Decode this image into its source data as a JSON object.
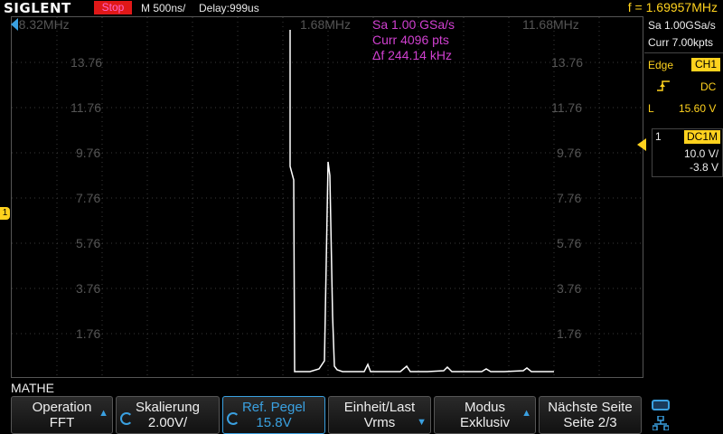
{
  "topbar": {
    "logo": "SIGLENT",
    "status": "Stop",
    "timebase": "M 500ns/",
    "delay": "Delay:999us",
    "frequency": "f = 1.69957MHz"
  },
  "grid": {
    "header": {
      "left": "-8.32MHz",
      "center": "1.68MHz",
      "right": "11.68MHz"
    },
    "scale_labels": [
      "13.76",
      "11.76",
      "9.76",
      "7.76",
      "5.76",
      "3.76",
      "1.76"
    ],
    "measurements": [
      "Sa 1.00 GSa/s",
      "Curr 4096 pts",
      "Δf 244.14 kHz"
    ],
    "trace_color": "#ffffff",
    "label_color": "#d040d0",
    "channel_marker": "1"
  },
  "right_panel": {
    "sample_rate": "Sa 1.00GSa/s",
    "memory": "Curr 7.00kpts",
    "trigger_type": "Edge",
    "trigger_source": "CH1",
    "coupling": "DC",
    "level_label": "L",
    "level_value": "15.60 V",
    "channel_number": "1",
    "channel_coupling": "DC1M",
    "volts_div": "10.0 V/",
    "offset": "-3.8 V",
    "accent": "#ffd21e"
  },
  "bottom": {
    "menu_title": "MATHE",
    "softkeys": [
      {
        "line1": "Operation",
        "line2": "FFT"
      },
      {
        "line1": "Skalierung",
        "line2": "2.00V/"
      },
      {
        "line1": "Ref. Pegel",
        "line2": "15.8V"
      },
      {
        "line1": "Einheit/Last",
        "line2": "Vrms"
      },
      {
        "line1": "Modus",
        "line2": "Exklusiv"
      },
      {
        "line1": "Nächste Seite",
        "line2": "Seite 2/3"
      }
    ]
  }
}
